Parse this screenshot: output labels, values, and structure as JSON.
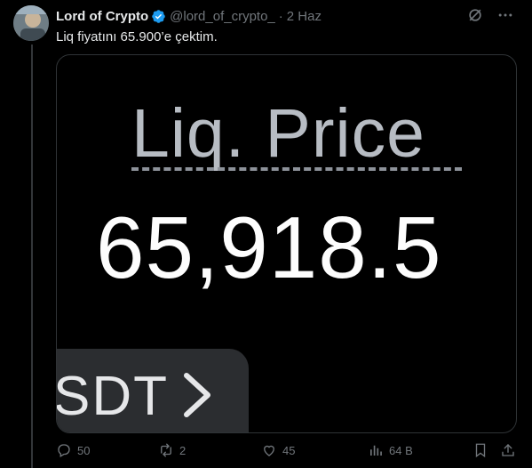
{
  "author": {
    "name": "Lord of Crypto",
    "handle": "@lord_of_crypto_",
    "separator": "·",
    "date": "2 Haz"
  },
  "tweet": {
    "text": "Liq fiyatını 65.900’e çektim."
  },
  "media": {
    "label": "Liq. Price",
    "value": "65,918.5",
    "button_fragment": "SDT"
  },
  "actions": {
    "replies": "50",
    "reposts": "2",
    "likes": "45",
    "views": "64 B"
  },
  "icons": {
    "verified": "verified-badge-icon",
    "grok": "grok-icon",
    "more": "more-icon",
    "reply": "reply-icon",
    "repost": "repost-icon",
    "like": "heart-icon",
    "views": "views-icon",
    "bookmark": "bookmark-icon",
    "share": "share-icon"
  },
  "colors": {
    "verified": "#1d9bf0",
    "muted": "#71767b",
    "text": "#e7e9ea",
    "background": "#000000"
  }
}
